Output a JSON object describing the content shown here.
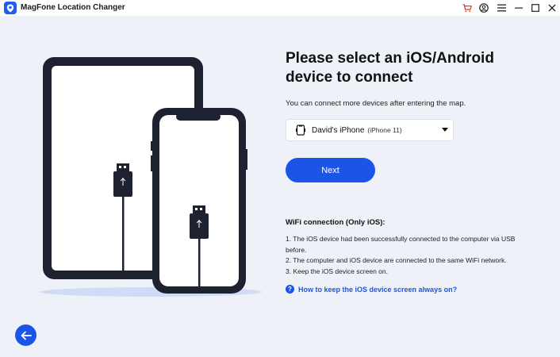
{
  "app": {
    "title": "MagFone Location Changer"
  },
  "window_controls": [
    "cart-icon",
    "account-icon",
    "menu-icon",
    "minimize-icon",
    "maximize-icon",
    "close-icon"
  ],
  "colors": {
    "accent": "#1a55e8",
    "background": "#eef2f8",
    "device_frame": "#1e2130",
    "cart": "#e03a2f"
  },
  "main": {
    "heading_line1": "Please select an iOS/Android",
    "heading_line2": "device to connect",
    "subtext": "You can connect more devices after entering the map.",
    "device_select": {
      "name": "David's iPhone",
      "model": "(iPhone 11)"
    },
    "next_label": "Next",
    "wifi": {
      "title": "WiFi connection (Only iOS):",
      "items": [
        "1. The iOS device had been successfully connected to the computer via USB before.",
        "2. The computer and iOS device are connected to the same WiFi network.",
        "3. Keep the iOS device screen on."
      ]
    },
    "help_link": "How to keep the iOS device screen always on?"
  }
}
